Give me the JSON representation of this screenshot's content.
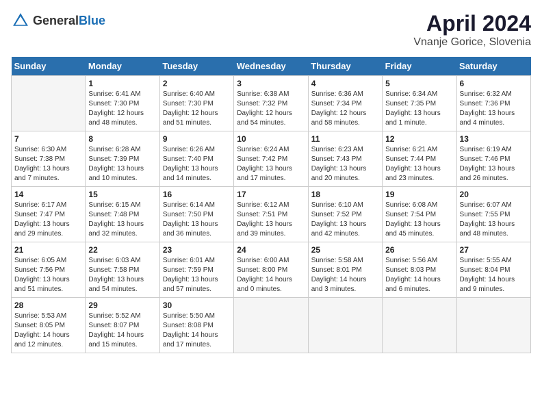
{
  "header": {
    "logo_general": "General",
    "logo_blue": "Blue",
    "title": "April 2024",
    "location": "Vnanje Gorice, Slovenia"
  },
  "days_of_week": [
    "Sunday",
    "Monday",
    "Tuesday",
    "Wednesday",
    "Thursday",
    "Friday",
    "Saturday"
  ],
  "weeks": [
    [
      {
        "day": "",
        "empty": true
      },
      {
        "day": "1",
        "sunrise": "Sunrise: 6:41 AM",
        "sunset": "Sunset: 7:30 PM",
        "daylight": "Daylight: 12 hours and 48 minutes."
      },
      {
        "day": "2",
        "sunrise": "Sunrise: 6:40 AM",
        "sunset": "Sunset: 7:30 PM",
        "daylight": "Daylight: 12 hours and 51 minutes."
      },
      {
        "day": "3",
        "sunrise": "Sunrise: 6:38 AM",
        "sunset": "Sunset: 7:32 PM",
        "daylight": "Daylight: 12 hours and 54 minutes."
      },
      {
        "day": "4",
        "sunrise": "Sunrise: 6:36 AM",
        "sunset": "Sunset: 7:34 PM",
        "daylight": "Daylight: 12 hours and 58 minutes."
      },
      {
        "day": "5",
        "sunrise": "Sunrise: 6:34 AM",
        "sunset": "Sunset: 7:35 PM",
        "daylight": "Daylight: 13 hours and 1 minute."
      },
      {
        "day": "6",
        "sunrise": "Sunrise: 6:32 AM",
        "sunset": "Sunset: 7:36 PM",
        "daylight": "Daylight: 13 hours and 4 minutes."
      }
    ],
    [
      {
        "day": "7",
        "sunrise": "Sunrise: 6:30 AM",
        "sunset": "Sunset: 7:38 PM",
        "daylight": "Daylight: 13 hours and 7 minutes."
      },
      {
        "day": "8",
        "sunrise": "Sunrise: 6:28 AM",
        "sunset": "Sunset: 7:39 PM",
        "daylight": "Daylight: 13 hours and 10 minutes."
      },
      {
        "day": "9",
        "sunrise": "Sunrise: 6:26 AM",
        "sunset": "Sunset: 7:40 PM",
        "daylight": "Daylight: 13 hours and 14 minutes."
      },
      {
        "day": "10",
        "sunrise": "Sunrise: 6:24 AM",
        "sunset": "Sunset: 7:42 PM",
        "daylight": "Daylight: 13 hours and 17 minutes."
      },
      {
        "day": "11",
        "sunrise": "Sunrise: 6:23 AM",
        "sunset": "Sunset: 7:43 PM",
        "daylight": "Daylight: 13 hours and 20 minutes."
      },
      {
        "day": "12",
        "sunrise": "Sunrise: 6:21 AM",
        "sunset": "Sunset: 7:44 PM",
        "daylight": "Daylight: 13 hours and 23 minutes."
      },
      {
        "day": "13",
        "sunrise": "Sunrise: 6:19 AM",
        "sunset": "Sunset: 7:46 PM",
        "daylight": "Daylight: 13 hours and 26 minutes."
      }
    ],
    [
      {
        "day": "14",
        "sunrise": "Sunrise: 6:17 AM",
        "sunset": "Sunset: 7:47 PM",
        "daylight": "Daylight: 13 hours and 29 minutes."
      },
      {
        "day": "15",
        "sunrise": "Sunrise: 6:15 AM",
        "sunset": "Sunset: 7:48 PM",
        "daylight": "Daylight: 13 hours and 32 minutes."
      },
      {
        "day": "16",
        "sunrise": "Sunrise: 6:14 AM",
        "sunset": "Sunset: 7:50 PM",
        "daylight": "Daylight: 13 hours and 36 minutes."
      },
      {
        "day": "17",
        "sunrise": "Sunrise: 6:12 AM",
        "sunset": "Sunset: 7:51 PM",
        "daylight": "Daylight: 13 hours and 39 minutes."
      },
      {
        "day": "18",
        "sunrise": "Sunrise: 6:10 AM",
        "sunset": "Sunset: 7:52 PM",
        "daylight": "Daylight: 13 hours and 42 minutes."
      },
      {
        "day": "19",
        "sunrise": "Sunrise: 6:08 AM",
        "sunset": "Sunset: 7:54 PM",
        "daylight": "Daylight: 13 hours and 45 minutes."
      },
      {
        "day": "20",
        "sunrise": "Sunrise: 6:07 AM",
        "sunset": "Sunset: 7:55 PM",
        "daylight": "Daylight: 13 hours and 48 minutes."
      }
    ],
    [
      {
        "day": "21",
        "sunrise": "Sunrise: 6:05 AM",
        "sunset": "Sunset: 7:56 PM",
        "daylight": "Daylight: 13 hours and 51 minutes."
      },
      {
        "day": "22",
        "sunrise": "Sunrise: 6:03 AM",
        "sunset": "Sunset: 7:58 PM",
        "daylight": "Daylight: 13 hours and 54 minutes."
      },
      {
        "day": "23",
        "sunrise": "Sunrise: 6:01 AM",
        "sunset": "Sunset: 7:59 PM",
        "daylight": "Daylight: 13 hours and 57 minutes."
      },
      {
        "day": "24",
        "sunrise": "Sunrise: 6:00 AM",
        "sunset": "Sunset: 8:00 PM",
        "daylight": "Daylight: 14 hours and 0 minutes."
      },
      {
        "day": "25",
        "sunrise": "Sunrise: 5:58 AM",
        "sunset": "Sunset: 8:01 PM",
        "daylight": "Daylight: 14 hours and 3 minutes."
      },
      {
        "day": "26",
        "sunrise": "Sunrise: 5:56 AM",
        "sunset": "Sunset: 8:03 PM",
        "daylight": "Daylight: 14 hours and 6 minutes."
      },
      {
        "day": "27",
        "sunrise": "Sunrise: 5:55 AM",
        "sunset": "Sunset: 8:04 PM",
        "daylight": "Daylight: 14 hours and 9 minutes."
      }
    ],
    [
      {
        "day": "28",
        "sunrise": "Sunrise: 5:53 AM",
        "sunset": "Sunset: 8:05 PM",
        "daylight": "Daylight: 14 hours and 12 minutes."
      },
      {
        "day": "29",
        "sunrise": "Sunrise: 5:52 AM",
        "sunset": "Sunset: 8:07 PM",
        "daylight": "Daylight: 14 hours and 15 minutes."
      },
      {
        "day": "30",
        "sunrise": "Sunrise: 5:50 AM",
        "sunset": "Sunset: 8:08 PM",
        "daylight": "Daylight: 14 hours and 17 minutes."
      },
      {
        "day": "",
        "empty": true
      },
      {
        "day": "",
        "empty": true
      },
      {
        "day": "",
        "empty": true
      },
      {
        "day": "",
        "empty": true
      }
    ]
  ]
}
